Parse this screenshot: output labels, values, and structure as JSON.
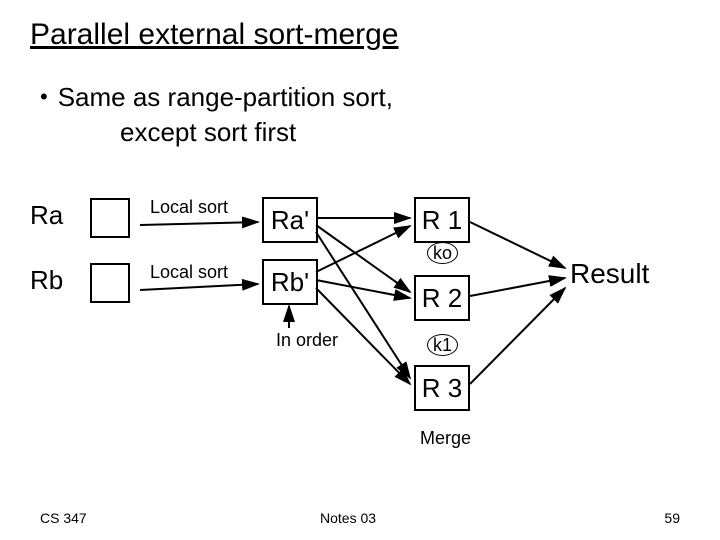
{
  "title": "Parallel external sort-merge",
  "bullet": {
    "line1": "Same as range-partition sort,",
    "line2": "except sort first"
  },
  "inputs": {
    "a": "Ra",
    "b": "Rb"
  },
  "arrow_labels": {
    "local_sort_a": "Local sort",
    "local_sort_b": "Local sort",
    "in_order": "In order"
  },
  "sorted": {
    "a": "Ra'",
    "b": "Rb'"
  },
  "ranges": {
    "r1": "R 1",
    "r2": "R 2",
    "r3": "R 3"
  },
  "vectors": {
    "ko": "ko",
    "k1": "k1"
  },
  "result": "Result",
  "merge": "Merge",
  "footer": {
    "left": "CS 347",
    "center": "Notes 03",
    "right": "59"
  }
}
